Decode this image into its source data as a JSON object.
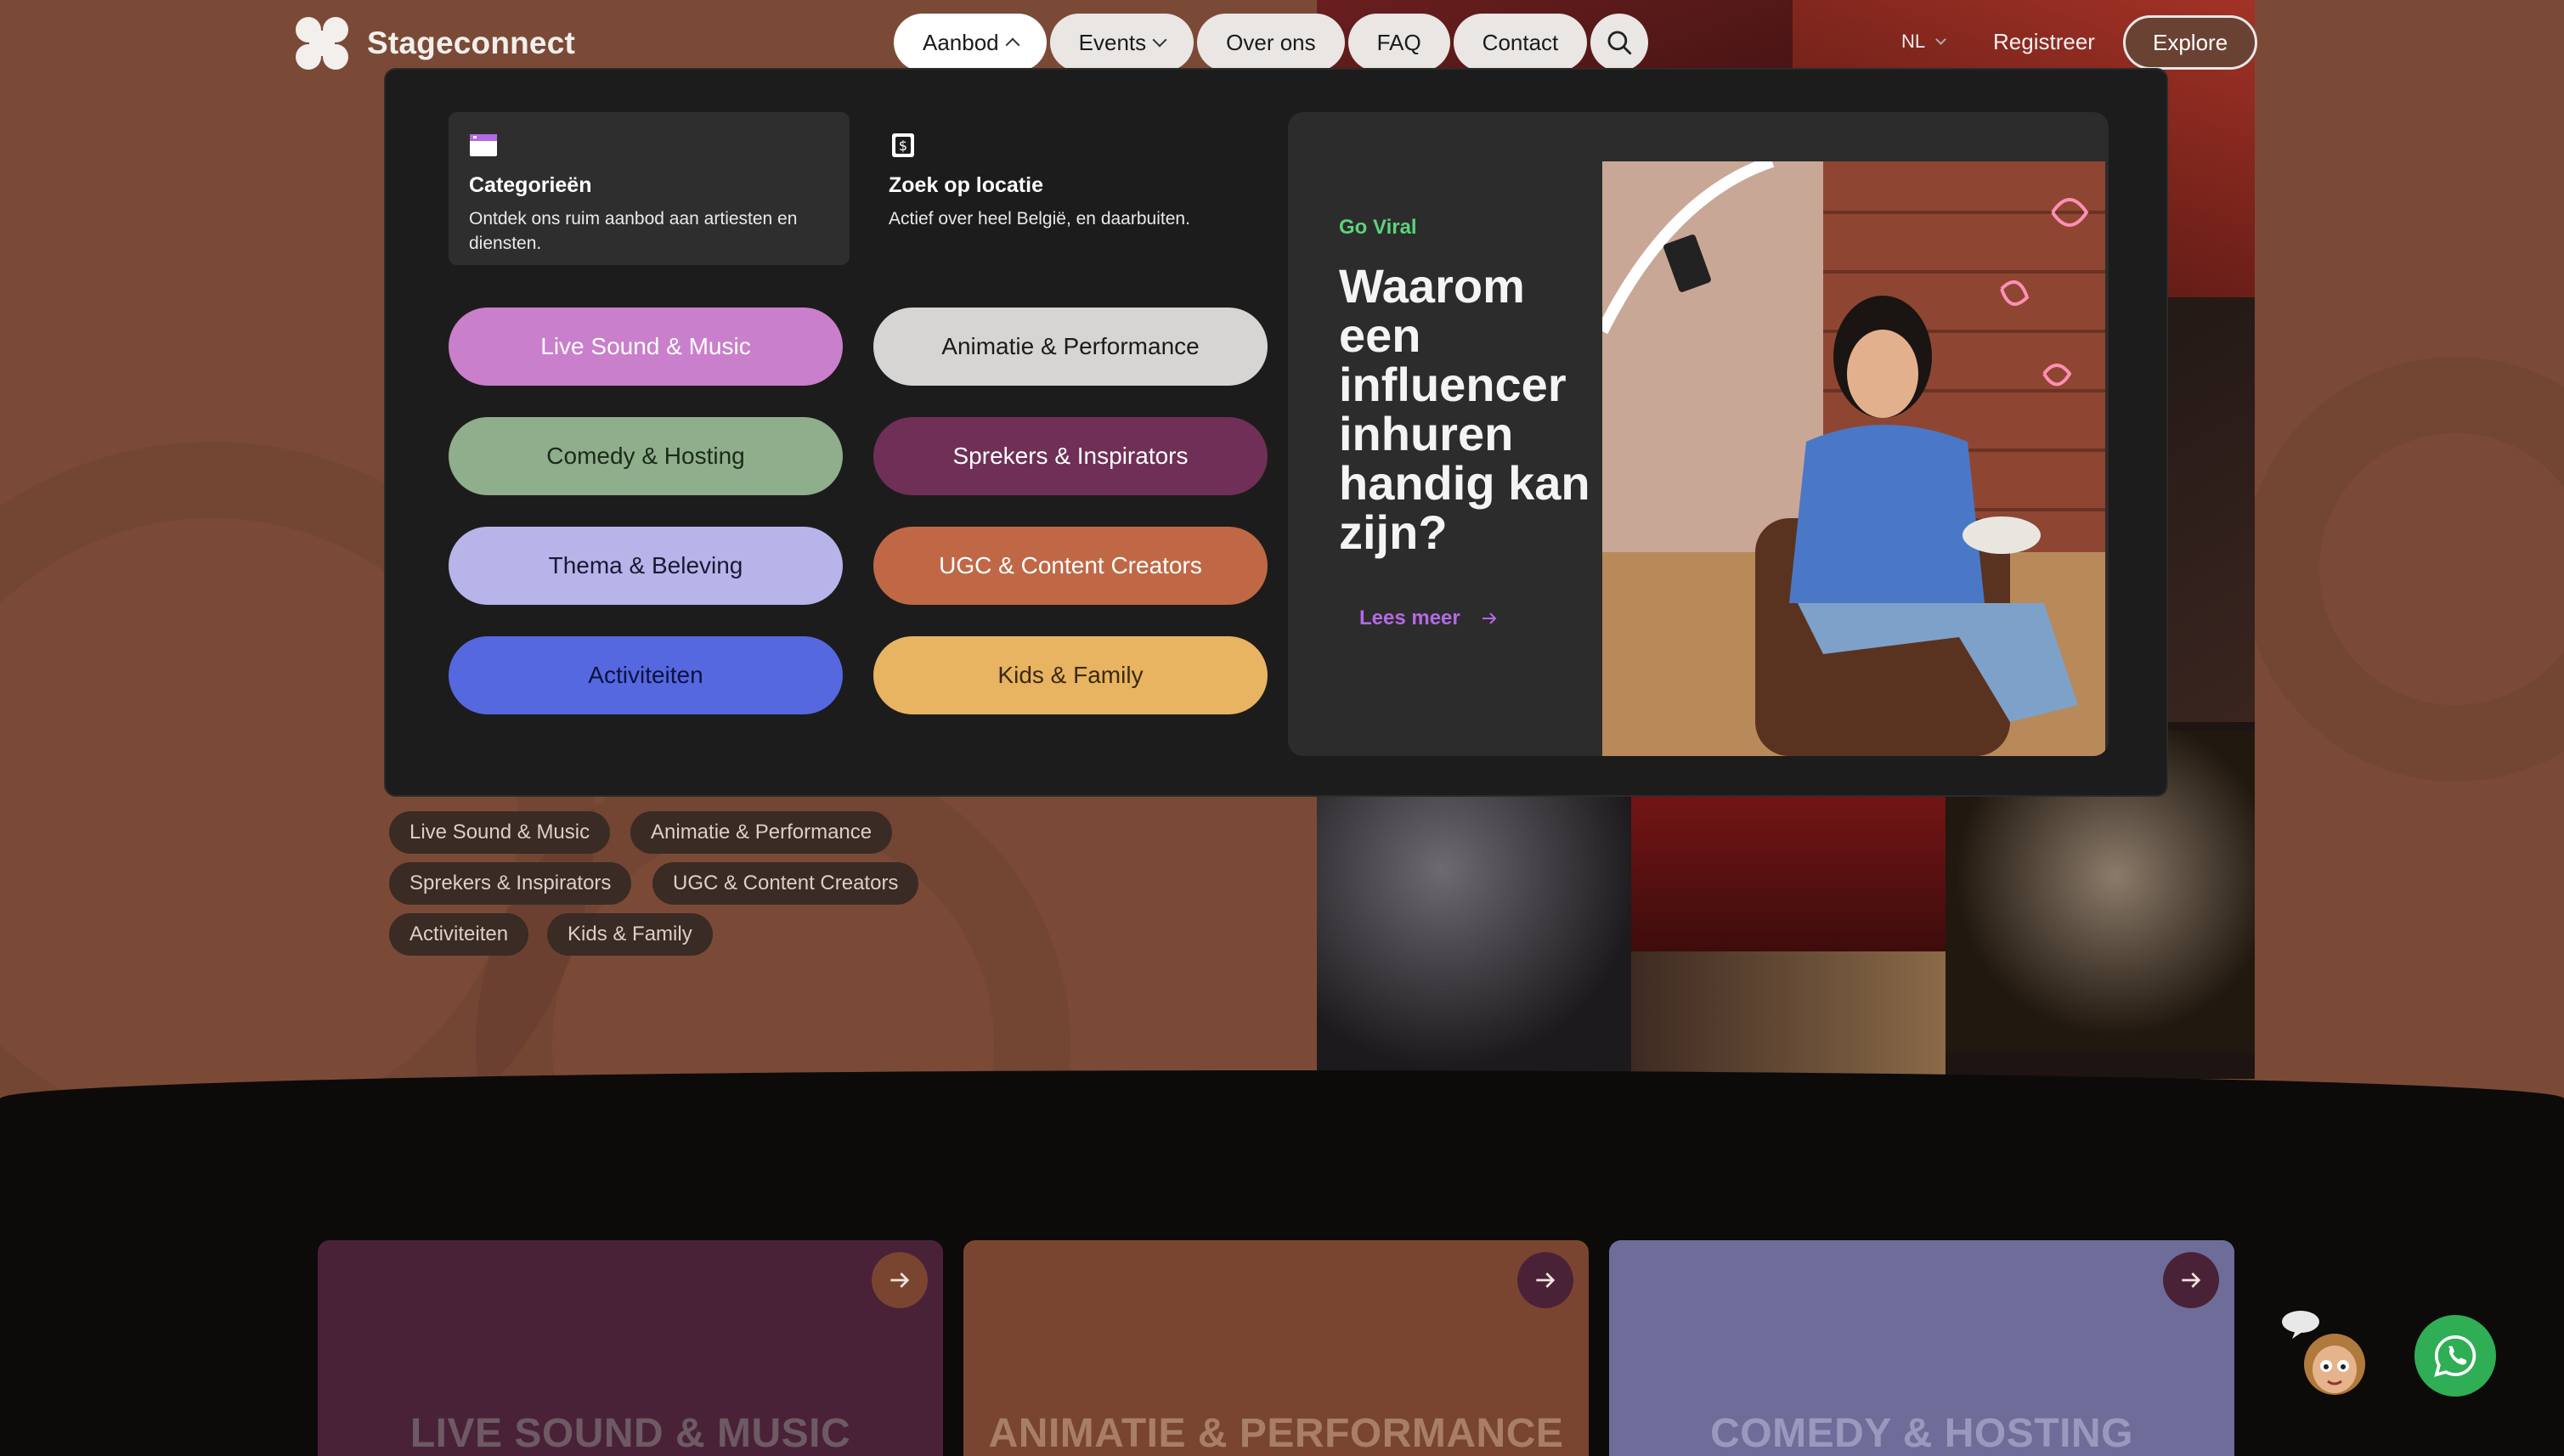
{
  "brand": {
    "name": "Stageconnect"
  },
  "nav": {
    "items": [
      {
        "label": "Aanbod"
      },
      {
        "label": "Events"
      },
      {
        "label": "Over ons"
      },
      {
        "label": "FAQ"
      },
      {
        "label": "Contact"
      }
    ],
    "language": "NL",
    "register": "Registreer",
    "explore": "Explore"
  },
  "menu": {
    "cards": [
      {
        "title": "Categorieën",
        "description": "Ontdek ons ruim aanbod aan artiesten en diensten."
      },
      {
        "title": "Zoek op locatie",
        "description": "Actief over heel België, en daarbuiten."
      }
    ],
    "categories": [
      {
        "label": "Live Sound & Music",
        "color": "#c97fcc"
      },
      {
        "label": "Animatie & Performance",
        "color": "#d6d5d3"
      },
      {
        "label": "Comedy & Hosting",
        "color": "#8fae8b"
      },
      {
        "label": "Sprekers & Inspirators",
        "color": "#6f2f57"
      },
      {
        "label": "Thema & Beleving",
        "color": "#b7b4ea"
      },
      {
        "label": "UGC & Content Creators",
        "color": "#c06846"
      },
      {
        "label": "Activiteiten",
        "color": "#5568e0"
      },
      {
        "label": "Kids & Family",
        "color": "#e8b461"
      }
    ],
    "promo": {
      "kicker": "Go Viral",
      "headline": "Waarom een influencer inhuren handig kan zijn?",
      "cta": "Lees meer"
    }
  },
  "tags": [
    "Live Sound & Music",
    "Animatie & Performance",
    "Sprekers & Inspirators",
    "UGC & Content Creators",
    "Activiteiten",
    "Kids & Family"
  ],
  "sections": [
    {
      "label": "LIVE SOUND & MUSIC",
      "color": "#4a2238"
    },
    {
      "label": "ANIMATIE & PERFORMANCE",
      "color": "#7a4530"
    },
    {
      "label": "COMEDY & HOSTING",
      "color": "#6e6d99"
    }
  ],
  "colors": {
    "accent_green": "#5bd47b",
    "accent_purple": "#b26ae6",
    "whatsapp": "#2fae55"
  }
}
